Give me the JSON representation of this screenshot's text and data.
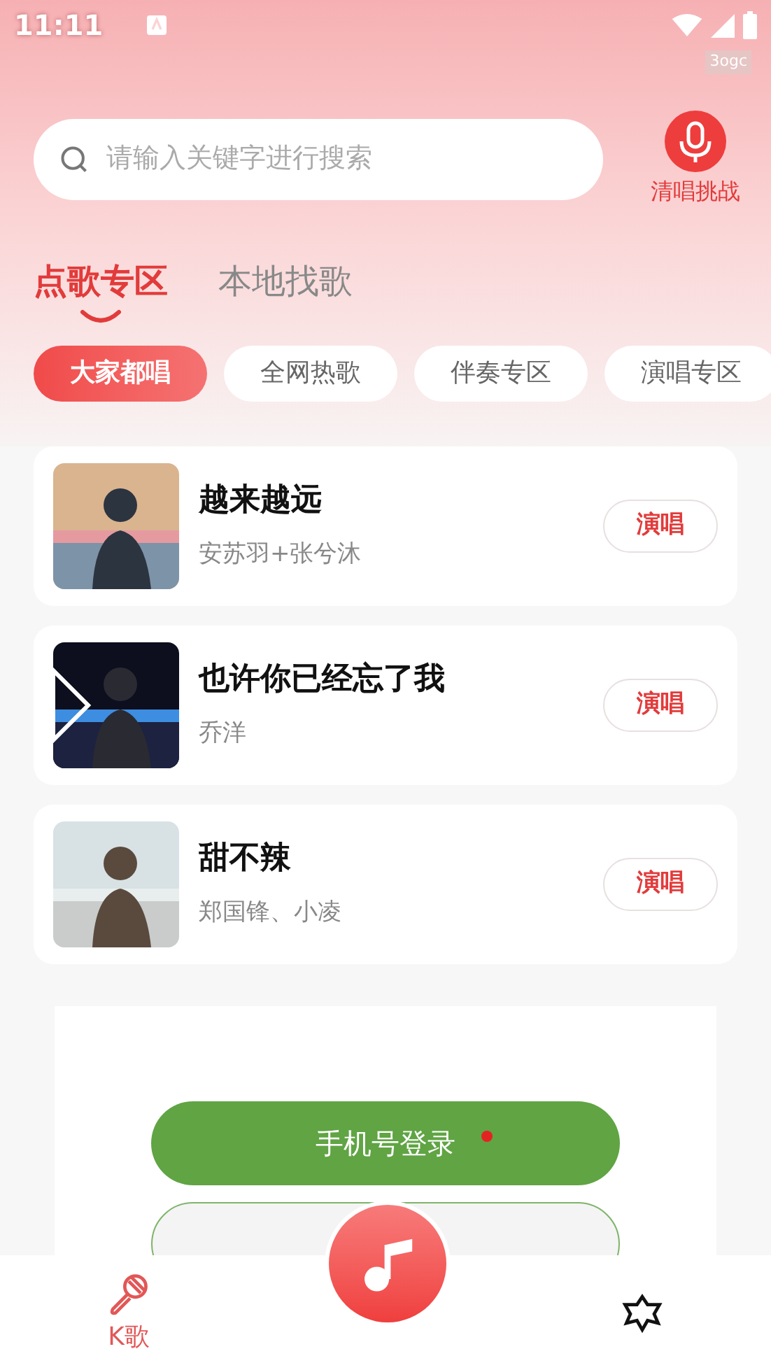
{
  "status_bar": {
    "time": "11:11",
    "badge": "3ogc"
  },
  "search": {
    "placeholder": "请输入关键字进行搜索"
  },
  "challenge": {
    "label": "清唱挑战"
  },
  "tabs": [
    {
      "label": "点歌专区",
      "selected": true
    },
    {
      "label": "本地找歌",
      "selected": false
    }
  ],
  "chips": [
    {
      "label": "大家都唱",
      "selected": true
    },
    {
      "label": "全网热歌",
      "selected": false
    },
    {
      "label": "伴奏专区",
      "selected": false
    },
    {
      "label": "演唱专区",
      "selected": false
    }
  ],
  "songs": [
    {
      "title": "越来越远",
      "artist": "安苏羽+张兮沐",
      "action": "演唱"
    },
    {
      "title": "也许你已经忘了我",
      "artist": "乔洋",
      "action": "演唱"
    },
    {
      "title": "甜不辣",
      "artist": "郑国锋、小凌",
      "action": "演唱"
    }
  ],
  "login": {
    "button": "手机号登录",
    "notice_dot": true
  },
  "nav": [
    {
      "kind": "tab",
      "label": "K歌",
      "selected": true
    },
    {
      "kind": "center"
    },
    {
      "kind": "tab",
      "selected": false
    }
  ]
}
